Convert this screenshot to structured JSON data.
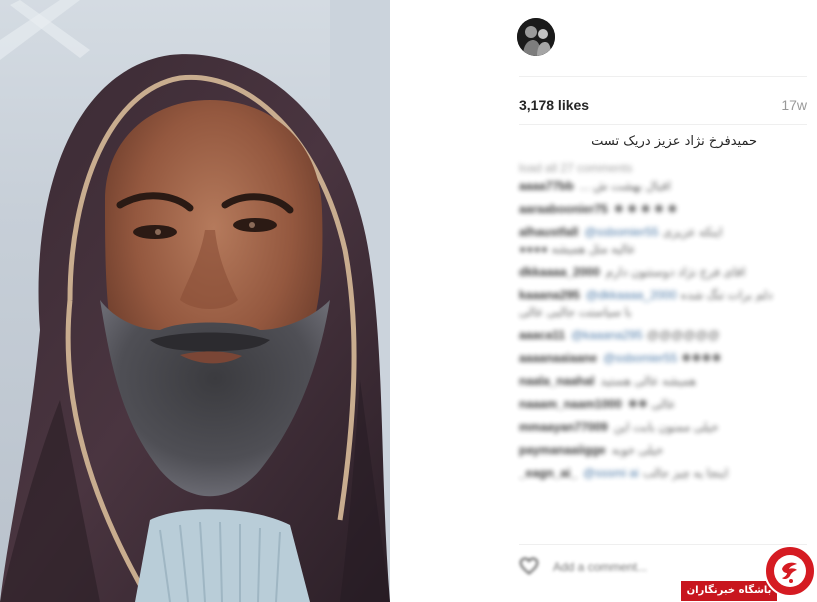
{
  "post": {
    "likes": "3,178 likes",
    "time": "17w",
    "caption": "حمیدفرخ نژاد عزیز دریک تست"
  },
  "comments": {
    "load_more": "load all 27 comments",
    "items": [
      {
        "user": "aaaa77bb",
        "mention": "",
        "text": "... اقبال بهشت ش",
        "extra": ""
      },
      {
        "user": "aaraaboonier75",
        "mention": "",
        "text": "✱ ✱ ✱ ✱ ✱",
        "extra": ""
      },
      {
        "user": "alhaustfall",
        "mention": "@ssbomier55",
        "text": "اینکه عزیزی",
        "extra": "●●●● عالیه مثل همیشه"
      },
      {
        "user": "dkkaaaa_2000",
        "mention": "",
        "text": "اقای فرخ نژاد دوستتون دارم",
        "extra": ""
      },
      {
        "user": "kaaana295",
        "mention": "@dkkaaaa_2000",
        "text": "دلم برات تنگ شده",
        "extra": "با سیاستت جالبی عالی"
      },
      {
        "user": "aaaca11",
        "mention": "@kaaana295",
        "text": "@@@@@@",
        "extra": ""
      },
      {
        "user": "aaaanaaiaane",
        "mention": "@ssbomier55",
        "text": "✱✱✱✱",
        "extra": ""
      },
      {
        "user": "naala_naahal",
        "mention": "",
        "text": "همیشه عالی هستید",
        "extra": ""
      },
      {
        "user": "naaam_naam1000",
        "mention": "",
        "text": "✱✱ عالی",
        "extra": ""
      },
      {
        "user": "mmaayan77009",
        "mention": "",
        "text": "خیلی ممنون بابت این",
        "extra": ""
      },
      {
        "user": "paymanaaiigge",
        "mention": "",
        "text": "خیلی خوبه",
        "extra": ""
      },
      {
        "user": "_eagn_ai_",
        "mention": "@sssmi ai",
        "text": "اینجا یه چیز جالب",
        "extra": ""
      }
    ]
  },
  "comment_box": {
    "placeholder": "Add a comment..."
  },
  "watermark": {
    "banner_text": "باشگاه خبرنگاران",
    "logo_glyph": "ج",
    "color": "#c8161e"
  },
  "icons": {
    "avatar": "profile-avatar",
    "like": "heart-icon",
    "logo": "yjc-logo-icon"
  }
}
